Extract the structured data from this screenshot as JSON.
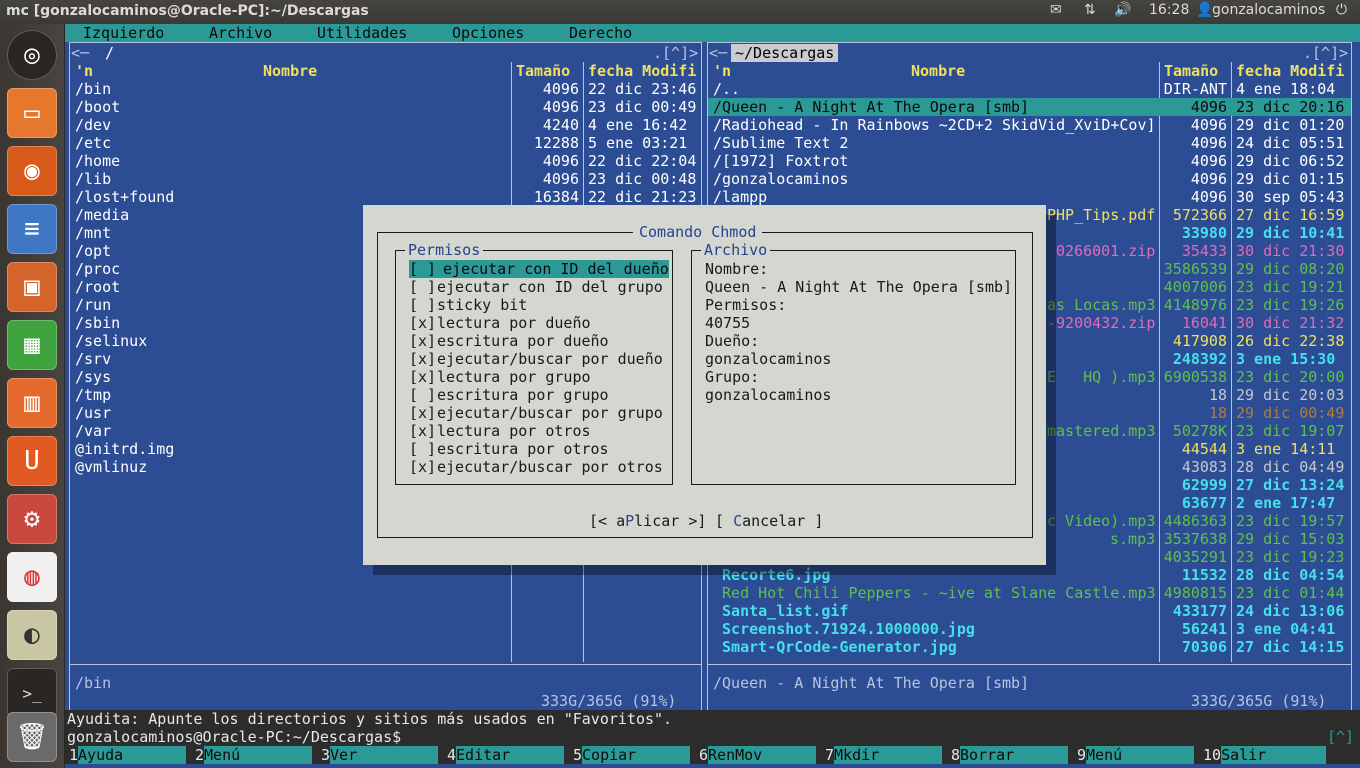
{
  "window": {
    "title": "mc [gonzalocaminos@Oracle-PC]:~/Descargas",
    "clock": "16:28",
    "user": "gonzalocaminos"
  },
  "menubar": [
    "Izquierdo",
    "Archivo",
    "Utilidades",
    "Opciones",
    "Derecho"
  ],
  "left_panel": {
    "path": "/",
    "corner": ".[^]>",
    "col_n": "'n",
    "col_name": "Nombre",
    "col_size": "Tamaño",
    "col_date": "fecha Modifi",
    "rows": [
      {
        "name": "/bin",
        "size": "4096",
        "date": "22 dic 23:46"
      },
      {
        "name": "/boot",
        "size": "4096",
        "date": "23 dic 00:49"
      },
      {
        "name": "/dev",
        "size": "4240",
        "date": "4 ene 16:42"
      },
      {
        "name": "/etc",
        "size": "12288",
        "date": "5 ene 03:21"
      },
      {
        "name": "/home",
        "size": "4096",
        "date": "22 dic 22:04"
      },
      {
        "name": "/lib",
        "size": "4096",
        "date": "23 dic 00:48"
      },
      {
        "name": "/lost+found",
        "size": "16384",
        "date": "22 dic 21:23"
      },
      {
        "name": "/media",
        "size": "",
        "date": ""
      },
      {
        "name": "/mnt",
        "size": "",
        "date": ""
      },
      {
        "name": "/opt",
        "size": "",
        "date": ""
      },
      {
        "name": "/proc",
        "size": "",
        "date": ""
      },
      {
        "name": "/root",
        "size": "",
        "date": ""
      },
      {
        "name": "/run",
        "size": "",
        "date": ""
      },
      {
        "name": "/sbin",
        "size": "",
        "date": ""
      },
      {
        "name": "/selinux",
        "size": "",
        "date": ""
      },
      {
        "name": "/srv",
        "size": "",
        "date": ""
      },
      {
        "name": "/sys",
        "size": "",
        "date": ""
      },
      {
        "name": "/tmp",
        "size": "",
        "date": ""
      },
      {
        "name": "/usr",
        "size": "",
        "date": ""
      },
      {
        "name": "/var",
        "size": "",
        "date": ""
      },
      {
        "name": "@initrd.img",
        "size": "",
        "date": ""
      },
      {
        "name": "@vmlinuz",
        "size": "",
        "date": ""
      }
    ],
    "status": "/bin",
    "disk": "333G/365G (91%)"
  },
  "right_panel": {
    "path": "~/Descargas",
    "corner": ".[^]>",
    "col_n": "'n",
    "col_name": "Nombre",
    "col_size": "Tamaño",
    "col_date": "fecha Modifi",
    "rows": [
      {
        "name": "/..",
        "size": "DIR-ANT",
        "date": "4 ene 18:04",
        "color": "wt"
      },
      {
        "name": "/Queen - A Night At The Opera [smb]",
        "size": "4096",
        "date": "23 dic 20:16",
        "color": "sel"
      },
      {
        "name": "/Radiohead - In Rainbows ~2CD+2 SkidVid_XviD+Cov]",
        "size": "4096",
        "date": "29 dic 01:20",
        "color": "wt"
      },
      {
        "name": "/Sublime Text 2",
        "size": "4096",
        "date": "24 dic 05:51",
        "color": "wt"
      },
      {
        "name": "/[1972] Foxtrot",
        "size": "4096",
        "date": "29 dic 06:52",
        "color": "wt"
      },
      {
        "name": "/gonzalocaminos",
        "size": "4096",
        "date": "29 dic 01:15",
        "color": "wt"
      },
      {
        "name": "/lampp",
        "size": "4096",
        "date": "30 sep 05:43",
        "color": "wt"
      },
      {
        "name": "PHP_Tips.pdf",
        "size": "572366",
        "date": "27 dic 16:59",
        "color": "yl"
      },
      {
        "name": "",
        "size": "33980",
        "date": "29 dic 10:41",
        "color": "cy"
      },
      {
        "name": "0266001.zip",
        "size": "35433",
        "date": "30 dic 21:30",
        "color": "mg"
      },
      {
        "name": "",
        "size": "3586539",
        "date": "29 dic 08:20",
        "color": "gn"
      },
      {
        "name": "",
        "size": "4007006",
        "date": "23 dic 19:21",
        "color": "gn"
      },
      {
        "name": "as Locas.mp3",
        "size": "4148976",
        "date": "23 dic 19:26",
        "color": "gn"
      },
      {
        "name": "-9200432.zip",
        "size": "16041",
        "date": "30 dic 21:32",
        "color": "mg"
      },
      {
        "name": "",
        "size": "417908",
        "date": "26 dic 22:38",
        "color": "yl"
      },
      {
        "name": "",
        "size": "248392",
        "date": "3 ene 15:30",
        "color": "cy"
      },
      {
        "name": "E   HQ ).mp3",
        "size": "6900538",
        "date": "23 dic 20:00",
        "color": "gn"
      },
      {
        "name": "",
        "size": "18",
        "date": "29 dic 20:03",
        "color": "gy"
      },
      {
        "name": "",
        "size": "18",
        "date": "29 dic 00:49",
        "color": "dk"
      },
      {
        "name": "mastered.mp3",
        "size": "50278K",
        "date": "23 dic 19:07",
        "color": "gn"
      },
      {
        "name": "",
        "size": "44544",
        "date": "3 ene 14:11",
        "color": "yl"
      },
      {
        "name": "",
        "size": "43083",
        "date": "28 dic 04:49",
        "color": "gy"
      },
      {
        "name": "",
        "size": "62999",
        "date": "27 dic 13:24",
        "color": "cy"
      },
      {
        "name": "",
        "size": "63677",
        "date": "2 ene 17:47",
        "color": "cy"
      },
      {
        "name": "c Video).mp3",
        "size": "4486363",
        "date": "23 dic 19:57",
        "color": "gn"
      },
      {
        "name": "s.mp3",
        "size": "3537638",
        "date": "29 dic 15:03",
        "color": "gn"
      },
      {
        "name": "",
        "size": "4035291",
        "date": "23 dic 19:23",
        "color": "gn"
      },
      {
        "name": " Recorte6.jpg",
        "size": "11532",
        "date": "28 dic 04:54",
        "color": "cy"
      },
      {
        "name": " Red Hot Chili Peppers - ~ive at Slane Castle.mp3",
        "size": "4980815",
        "date": "23 dic 01:44",
        "color": "gn"
      },
      {
        "name": " Santa_list.gif",
        "size": "433177",
        "date": "24 dic 13:06",
        "color": "cy"
      },
      {
        "name": " Screenshot.71924.1000000.jpg",
        "size": "56241",
        "date": "3 ene 04:41",
        "color": "cy"
      },
      {
        "name": " Smart-QrCode-Generator.jpg",
        "size": "70306",
        "date": "27 dic 14:15",
        "color": "cy"
      }
    ],
    "status": "/Queen - A Night At The Opera [smb]",
    "disk": "333G/365G (91%)"
  },
  "hint": "Ayudita: Apunte los directorios y sitios más usados en \"Favoritos\".",
  "prompt": "gonzalocaminos@Oracle-PC:~/Descargas$",
  "prompt_corner": "[^]",
  "fkeys": [
    {
      "n": "1",
      "label": "Ayuda"
    },
    {
      "n": "2",
      "label": "Menú"
    },
    {
      "n": "3",
      "label": "Ver"
    },
    {
      "n": "4",
      "label": "Editar"
    },
    {
      "n": "5",
      "label": "Copiar"
    },
    {
      "n": "6",
      "label": "RenMov"
    },
    {
      "n": "7",
      "label": "Mkdir"
    },
    {
      "n": "8",
      "label": "Borrar"
    },
    {
      "n": "9",
      "label": "Menú"
    },
    {
      "n": "10",
      "label": "Salir"
    }
  ],
  "dialog": {
    "title": "Comando Chmod",
    "perm_title": "Permisos",
    "file_title": "Archivo",
    "perms": [
      {
        "mark": "[ ]",
        "label": "ejecutar con ID del dueño"
      },
      {
        "mark": "[ ]",
        "label": "ejecutar con ID del grupo"
      },
      {
        "mark": "[ ]",
        "label": "sticky bit"
      },
      {
        "mark": "[x]",
        "label": "lectura por dueño"
      },
      {
        "mark": "[x]",
        "label": "escritura por dueño"
      },
      {
        "mark": "[x]",
        "label": "ejecutar/buscar por dueño"
      },
      {
        "mark": "[x]",
        "label": "lectura por grupo"
      },
      {
        "mark": "[ ]",
        "label": "escritura por grupo"
      },
      {
        "mark": "[x]",
        "label": "ejecutar/buscar por grupo"
      },
      {
        "mark": "[x]",
        "label": "lectura por otros"
      },
      {
        "mark": "[ ]",
        "label": "escritura por otros"
      },
      {
        "mark": "[x]",
        "label": "ejecutar/buscar por otros"
      }
    ],
    "file_lines": [
      "Nombre:",
      "Queen - A Night At The Opera [smb]",
      "Permisos:",
      "40755",
      "Dueño:",
      "gonzalocaminos",
      "Grupo:",
      "gonzalocaminos"
    ],
    "apply_pre": "[< a",
    "apply_hot": "P",
    "apply_post": "licar >]",
    "cancel_pre": "[ ",
    "cancel_hot": "C",
    "cancel_post": "ancelar ]"
  }
}
